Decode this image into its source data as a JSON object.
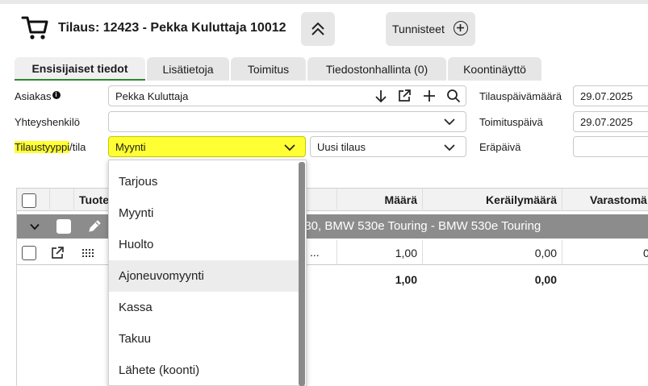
{
  "header": {
    "title": "Tilaus: 12423 - Pekka Kuluttaja 10012",
    "tags_label": "Tunnisteet"
  },
  "tabs": [
    {
      "label": "Ensisijaiset tiedot",
      "active": true
    },
    {
      "label": "Lisätietoja"
    },
    {
      "label": "Toimitus"
    },
    {
      "label": "Tiedostonhallinta (0)"
    },
    {
      "label": "Koontinäyttö"
    }
  ],
  "form": {
    "customer_label": "Asiakas",
    "customer_value": "Pekka Kuluttaja",
    "contact_label": "Yhteyshenkilö",
    "contact_value": "",
    "order_type_label_hl": "Tilaustyyppi",
    "order_type_label_rest": "/tila",
    "order_type_value": "Myynti",
    "status_value": "Uusi tilaus",
    "order_date_label": "Tilauspäivämäärä",
    "order_date_value": "29.07.2025",
    "delivery_date_label": "Toimituspäivä",
    "delivery_date_value": "29.07.2025",
    "due_date_label": "Eräpäivä",
    "due_date_value": ""
  },
  "table": {
    "col_product": "Tuote",
    "col_qty": "Määrä",
    "col_picked": "Keräilymäärä",
    "col_stock": "Varastomä",
    "group_text": "530, BMW 530e Touring - BMW 530e Touring",
    "row_ellipsis": "...",
    "row_qty": "1,00",
    "row_picked": "0,00",
    "row_stock": "0",
    "total_qty": "1,00",
    "total_picked": "0,00"
  },
  "dropdown": {
    "options": [
      "Tarjous",
      "Myynti",
      "Huolto",
      "Ajoneuvomyynti",
      "Kassa",
      "Takuu",
      "Lähete (koonti)"
    ],
    "hovered": "Ajoneuvomyynti"
  },
  "colors": {
    "highlight": "#ffff33",
    "active_tab_underline": "#2d8a2d",
    "group_row": "#8c8c8c"
  }
}
